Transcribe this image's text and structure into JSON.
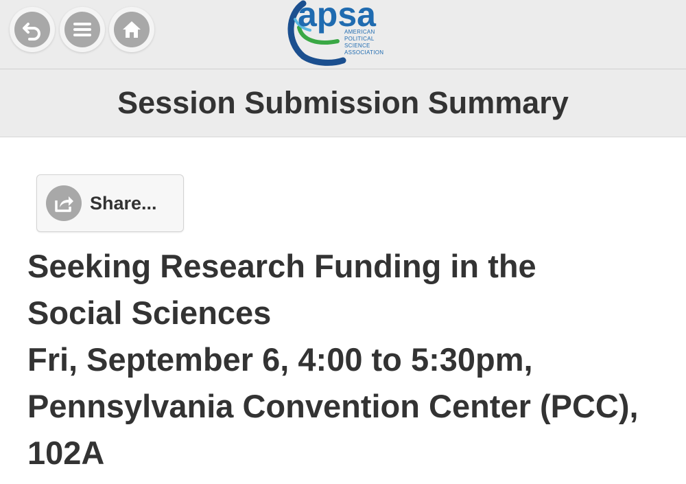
{
  "header": {
    "logo": {
      "wordmark": "apsa",
      "subtitle_lines": [
        "AMERICAN",
        "POLITICAL",
        "SCIENCE",
        "ASSOCIATION"
      ]
    },
    "nav_buttons": [
      {
        "icon": "back-icon"
      },
      {
        "icon": "menu-icon"
      },
      {
        "icon": "home-icon"
      }
    ]
  },
  "page": {
    "title": "Session Submission Summary"
  },
  "share": {
    "label": "Share...",
    "icon": "share-icon"
  },
  "session": {
    "title_line1": "Seeking Research Funding in the",
    "title_line2": "Social Sciences",
    "time_line": "Fri, September 6, 4:00 to 5:30pm,",
    "location_line": "Pennsylvania Convention Center (PCC),",
    "room_line": "102A"
  },
  "colors": {
    "bar_background": "#ececec",
    "icon_gray": "#a8a8a8",
    "text": "#333333",
    "logo_blue": "#1f6bb0",
    "logo_green": "#3aa845",
    "logo_navy": "#1b4f8f"
  }
}
